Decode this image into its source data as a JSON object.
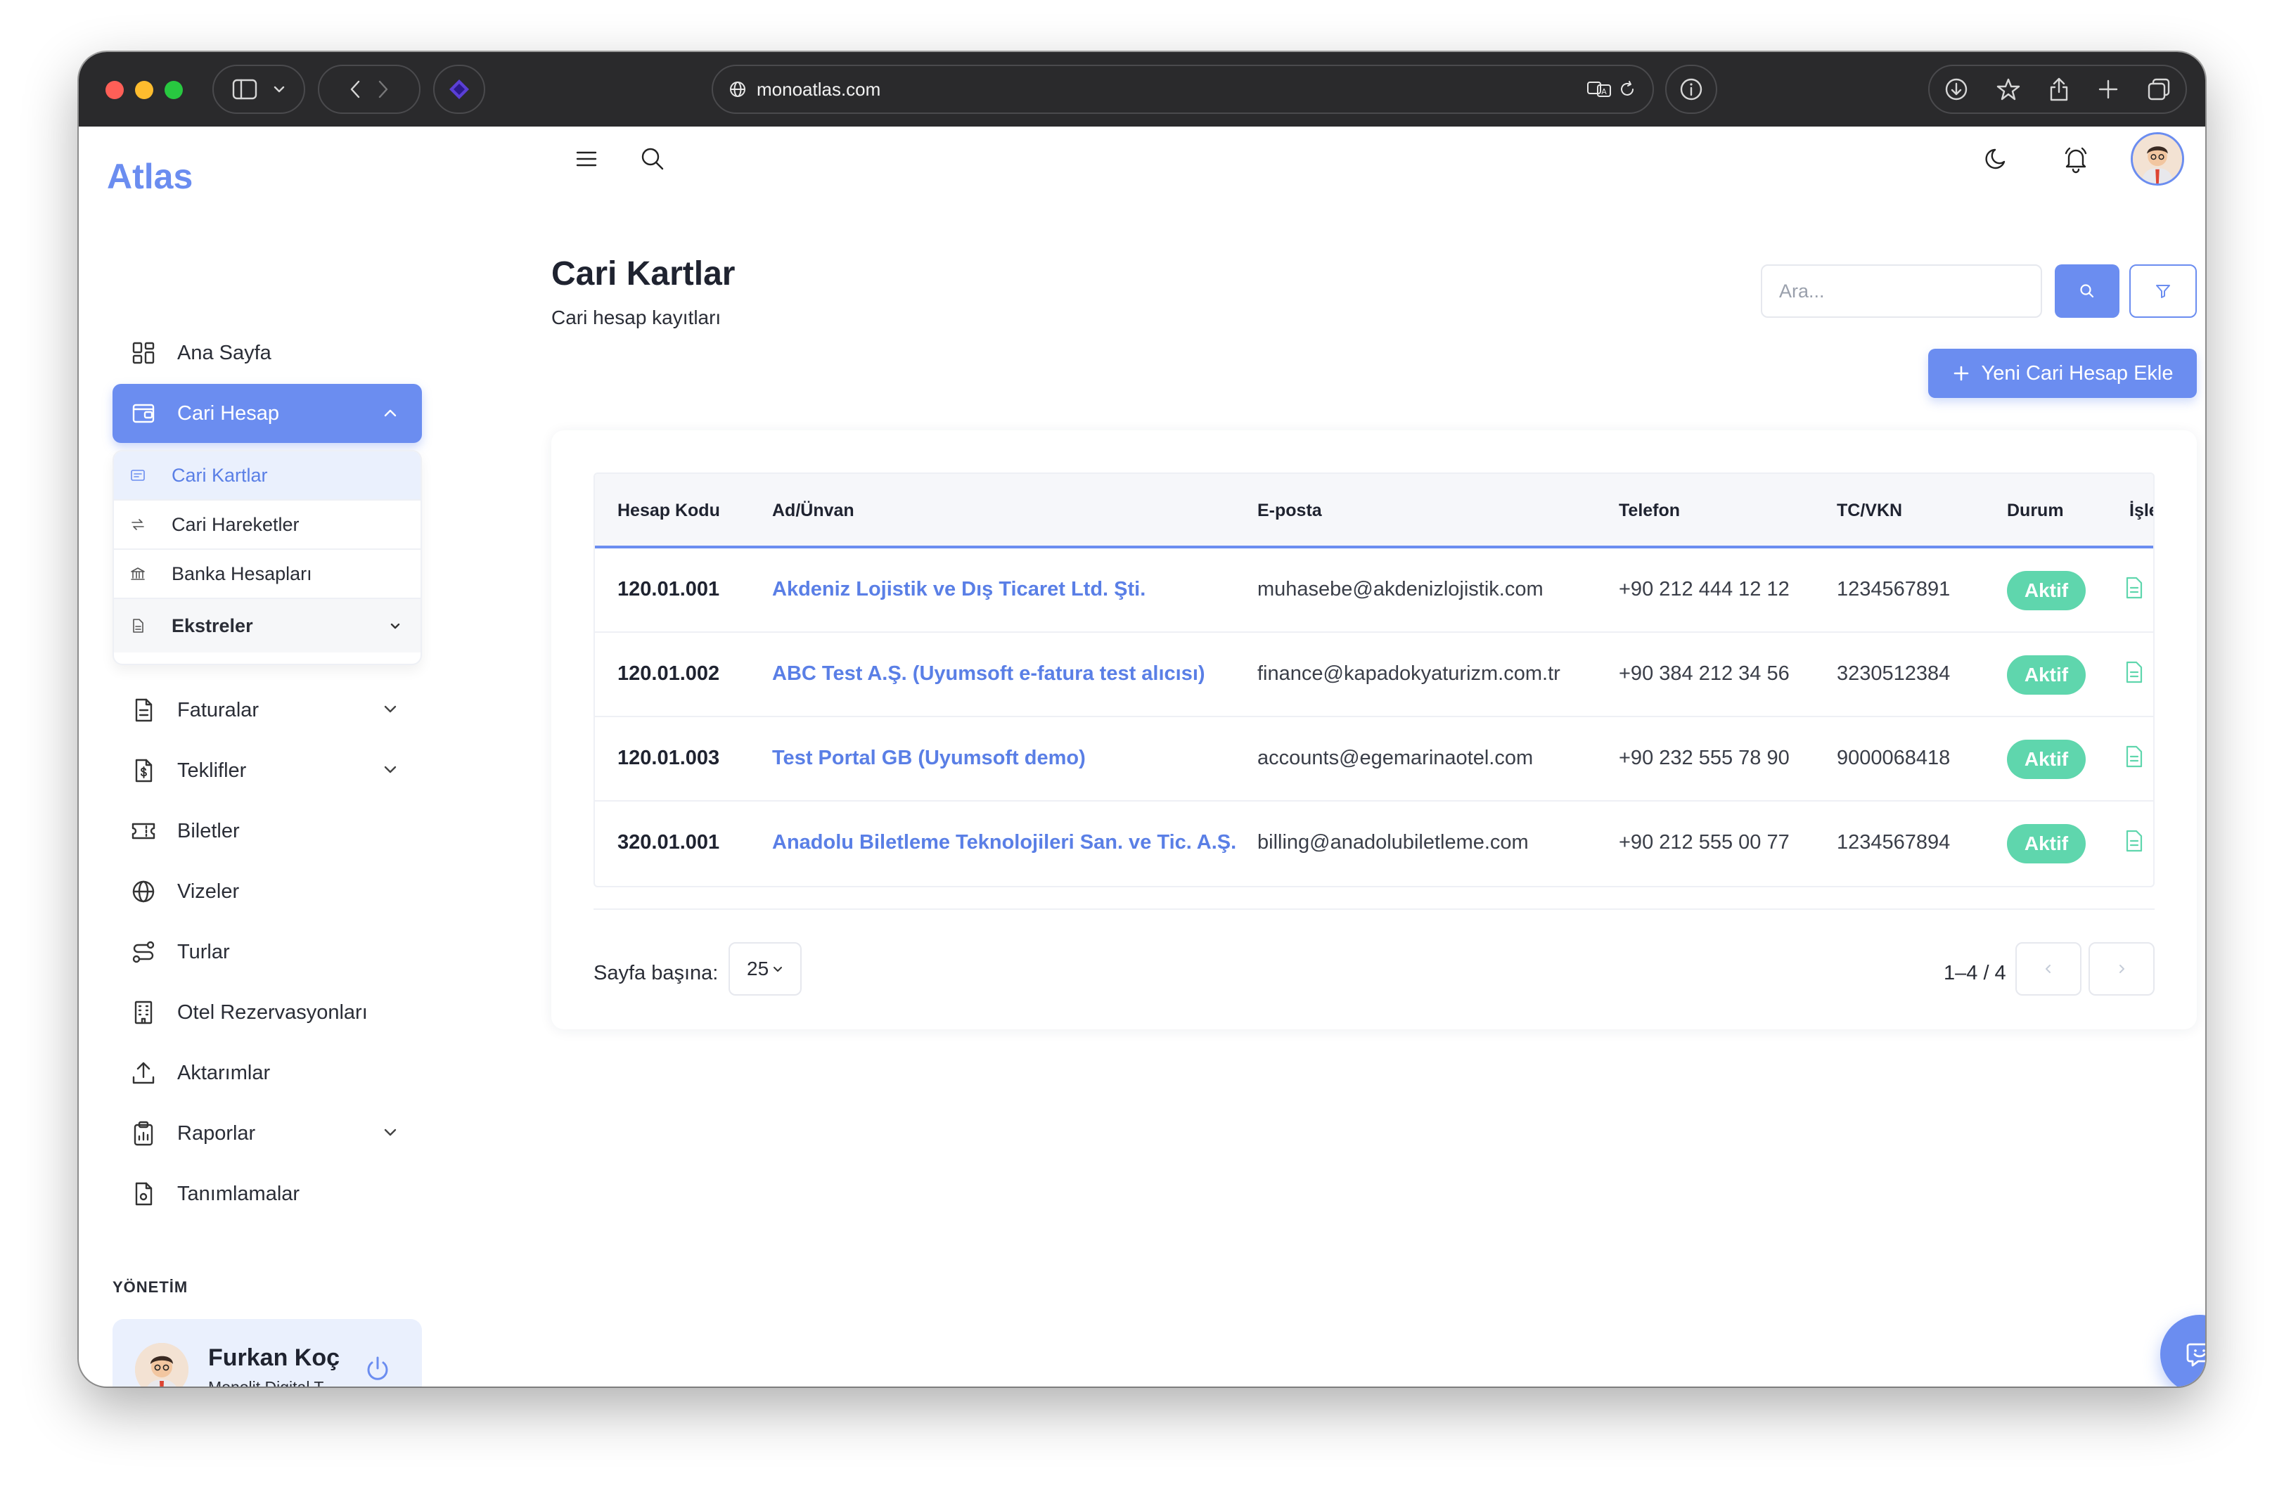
{
  "browser": {
    "url": "monoatlas.com",
    "traffic_lights": {
      "close": "#ff5f57",
      "minimize": "#febc2e",
      "zoom": "#28c840"
    }
  },
  "app": {
    "name": "Atlas",
    "accent": "#6b8df0",
    "success": "#5fd6ad"
  },
  "sidebar": {
    "items": [
      {
        "label": "Ana Sayfa",
        "icon": "grid-icon"
      },
      {
        "label": "Cari Hesap",
        "icon": "wallet-icon"
      },
      {
        "label": "Faturalar",
        "icon": "document-icon"
      },
      {
        "label": "Teklifler",
        "icon": "dollar-document-icon"
      },
      {
        "label": "Biletler",
        "icon": "ticket-icon"
      },
      {
        "label": "Vizeler",
        "icon": "globe-icon"
      },
      {
        "label": "Turlar",
        "icon": "route-icon"
      },
      {
        "label": "Otel Rezervasyonları",
        "icon": "building-icon"
      },
      {
        "label": "Aktarımlar",
        "icon": "upload-icon"
      },
      {
        "label": "Raporlar",
        "icon": "clipboard-icon"
      },
      {
        "label": "Tanımlamalar",
        "icon": "settings-document-icon"
      }
    ],
    "submenu": [
      {
        "label": "Cari Kartlar",
        "icon": "card-icon"
      },
      {
        "label": "Cari Hareketler",
        "icon": "swap-icon"
      },
      {
        "label": "Banka Hesapları",
        "icon": "bank-icon"
      },
      {
        "label": "Ekstreler",
        "icon": "file-icon"
      }
    ],
    "section_label": "YÖNETİM",
    "user": {
      "name": "Furkan Koç",
      "company": "Monolit Digital T..."
    }
  },
  "page": {
    "title": "Cari Kartlar",
    "subtitle": "Cari hesap kayıtları",
    "search_placeholder": "Ara...",
    "add_button": "Yeni Cari Hesap Ekle"
  },
  "table": {
    "columns": [
      "Hesap Kodu",
      "Ad/Ünvan",
      "E-posta",
      "Telefon",
      "TC/VKN",
      "Durum",
      "İşle"
    ],
    "rows": [
      {
        "code": "120.01.001",
        "name": "Akdeniz Lojistik ve Dış Ticaret Ltd. Şti.",
        "email": "muhasebe@akdenizlojistik.com",
        "phone": "+90 212 444 12 12",
        "tax": "1234567891",
        "status": "Aktif"
      },
      {
        "code": "120.01.002",
        "name": "ABC Test A.Ş. (Uyumsoft e-fatura test alıcısı)",
        "email": "finance@kapadokyaturizm.com.tr",
        "phone": "+90 384 212 34 56",
        "tax": "3230512384",
        "status": "Aktif"
      },
      {
        "code": "120.01.003",
        "name": "Test Portal GB (Uyumsoft demo)",
        "email": "accounts@egemarinaotel.com",
        "phone": "+90 232 555 78 90",
        "tax": "9000068418",
        "status": "Aktif"
      },
      {
        "code": "320.01.001",
        "name": "Anadolu Biletleme Teknolojileri San. ve Tic. A.Ş.",
        "email": "billing@anadolubiletleme.com",
        "phone": "+90 212 555 00 77",
        "tax": "1234567894",
        "status": "Aktif"
      }
    ]
  },
  "pagination": {
    "per_page_label": "Sayfa başına:",
    "per_page": "25",
    "range": "1–4 / 4"
  }
}
